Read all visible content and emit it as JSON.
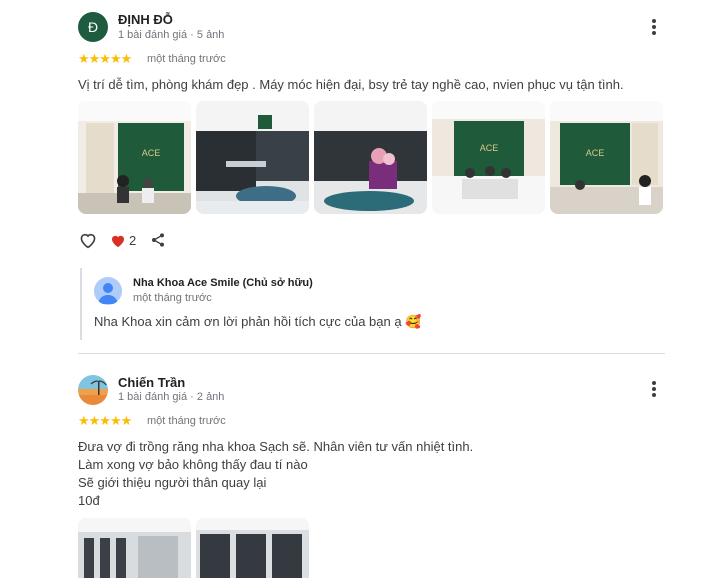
{
  "reviews": [
    {
      "avatar_letter": "Đ",
      "name": "ĐỊNH ĐỖ",
      "meta": "1 bài đánh giá · 5 ảnh",
      "stars": "★★★★★",
      "date": "một tháng trước",
      "text": "Vị trí dễ tìm, phòng khám đẹp . Máy móc hiện đại, bsy trẻ tay nghề cao, nvien phục vụ tận tình.",
      "like_count": "2",
      "owner_reply": {
        "name": "Nha Khoa Ace Smile (Chủ sở hữu)",
        "date": "một tháng trước",
        "text": "Nha Khoa xin cảm ơn lời phản hồi tích cực của bạn ạ 🥰"
      }
    },
    {
      "name": "Chiến Trần",
      "meta": "1 bài đánh giá · 2 ảnh",
      "stars": "★★★★★",
      "date": "một tháng trước",
      "text_lines": [
        "Đưa vợ đi trồng răng nha khoa Sạch sẽ. Nhân viên tư vấn nhiệt tình.",
        "Làm xong vợ bảo không thấy đau tí nào",
        "Sẽ giới thiệu người thân quay lại",
        "10đ"
      ]
    }
  ],
  "icons": {
    "like": "heart-outline-icon",
    "liked": "heart-filled-icon",
    "share": "share-icon",
    "more": "more-vert-icon",
    "owner_avatar": "person-icon"
  },
  "colors": {
    "star": "#fbbc04",
    "heart": "#d93025",
    "avatar_green": "#1e5b3f",
    "owner_avatar_blue": "#4285f4"
  }
}
